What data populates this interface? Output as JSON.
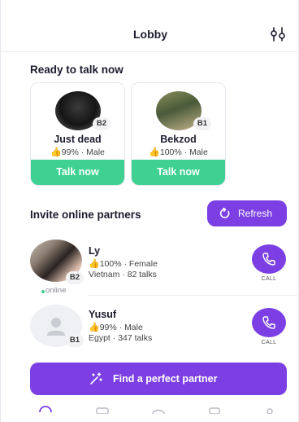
{
  "header": {
    "title": "Lobby",
    "filter_icon": "filter-sliders-icon"
  },
  "ready": {
    "title": "Ready to talk now",
    "cards": [
      {
        "name": "Just dead",
        "level": "B2",
        "rating": "99%",
        "gender": "Male",
        "button": "Talk now"
      },
      {
        "name": "Bekzod",
        "level": "B1",
        "rating": "100%",
        "gender": "Male",
        "button": "Talk now"
      }
    ]
  },
  "invite": {
    "title": "Invite online partners",
    "refresh_label": "Refresh",
    "partners": [
      {
        "name": "Ly",
        "level": "B2",
        "rating": "100%",
        "gender": "Female",
        "country": "Vietnam",
        "talks": "82 talks",
        "status": "online",
        "call_label": "CALL"
      },
      {
        "name": "Yusuf",
        "level": "B1",
        "rating": "99%",
        "gender": "Male",
        "country": "Egypt",
        "talks": "347 talks",
        "call_label": "CALL"
      }
    ]
  },
  "find_button": {
    "label": "Find a perfect partner",
    "icon": "magic-wand-icon"
  },
  "tabs": [
    "lobby-tab-icon",
    "chat-tab-icon",
    "community-tab-icon",
    "message-tab-icon",
    "profile-tab-icon"
  ],
  "colors": {
    "accent": "#7b3fe4",
    "talk_green": "#3fd191",
    "rating_yellow": "#f0b400"
  }
}
